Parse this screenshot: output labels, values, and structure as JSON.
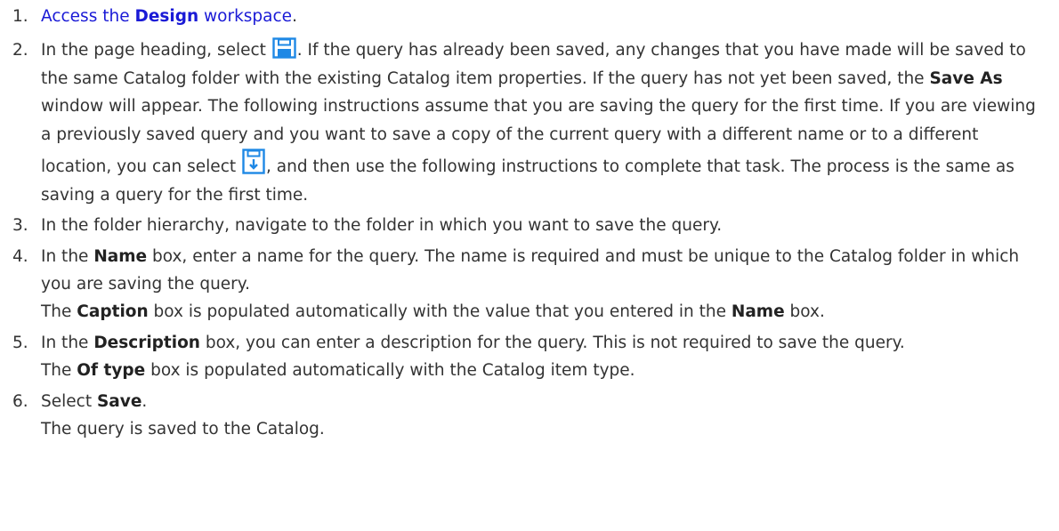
{
  "steps": [
    {
      "number": "1.",
      "before": "Access the ",
      "bold": "Design",
      "after": " workspace",
      "end": "."
    },
    {
      "number": "2.",
      "t1": "In the page heading, select ",
      "icon_save": "save-icon",
      "t2": ". If the query has already been saved, any changes that you have made will be saved to the same Catalog folder with the existing Catalog item properties. If the query has not yet been saved, the ",
      "b1": "Save As",
      "t3": " window will appear. The following instructions assume that you are saving the query for the first time. If you are viewing a previously saved query and you want to save a copy of the current query with a different name or to a different location, you can select ",
      "icon_save_as": "save-as-icon",
      "t4": ", and then use the following instructions to complete that task. The process is the same as saving a query for the first time."
    },
    {
      "number": "3.",
      "text": "In the folder hierarchy, navigate to the folder in which you want to save the query."
    },
    {
      "number": "4.",
      "t1": "In the ",
      "b1": "Name",
      "t2": " box, enter a name for the query. The name is required and must be unique to the Catalog folder in which you are saving the query.",
      "t3": "The ",
      "b2": "Caption",
      "t4": " box is populated automatically with the value that you entered in the ",
      "b3": "Name",
      "t5": " box."
    },
    {
      "number": "5.",
      "t1": "In the ",
      "b1": "Description",
      "t2": " box, you can enter a description for the query. This is not required to save the query.",
      "t3": "The ",
      "b2": "Of type",
      "t4": " box is populated automatically with the Catalog item type."
    },
    {
      "number": "6.",
      "t1": "Select ",
      "b1": "Save",
      "t2": ".",
      "t3": "The query is saved to the Catalog."
    }
  ],
  "colors": {
    "link": "#1a1ad6",
    "text": "#333333",
    "icon": "#1e88e5"
  }
}
